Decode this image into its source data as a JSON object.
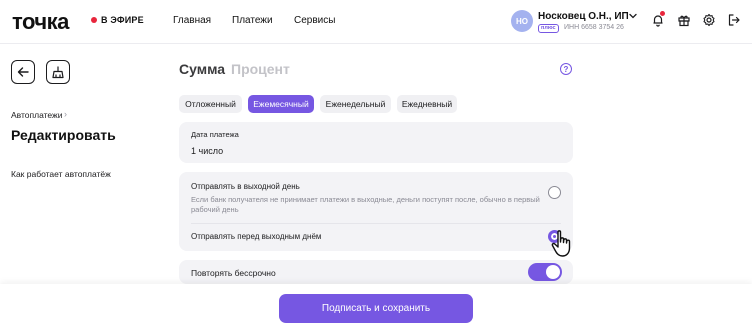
{
  "header": {
    "logo": "точка",
    "live_label": "В ЭФИРЕ",
    "nav": [
      "Главная",
      "Платежи",
      "Сервисы"
    ],
    "user": {
      "initials": "НО",
      "name": "Носковец О.Н., ИП",
      "badge": "плюс",
      "inn": "ИНН 6658 3754 26"
    },
    "icons": [
      "bell-icon",
      "gift-icon",
      "gear-icon",
      "exit-icon"
    ],
    "accent_color": "#7657e2",
    "notif_color": "#e8263c"
  },
  "sidebar": {
    "breadcrumb": "Автоплатежи",
    "title": "Редактировать",
    "help_link": "Как работает автоплатёж"
  },
  "main": {
    "mode_tabs": {
      "active": "Сумма",
      "inactive": "Процент"
    },
    "help": "?",
    "period_chips": [
      "Отложенный",
      "Ежемесячный",
      "Еженедельный",
      "Ежедневный"
    ],
    "selected_period": "Ежемесячный",
    "date": {
      "label": "Дата платежа",
      "value": "1 число"
    },
    "send_options": {
      "option1": {
        "title": "Отправлять в выходной день",
        "description": "Если банк получателя не принимает платежи в выходные, деньги поступят после, обычно в первый рабочий день",
        "selected": false
      },
      "option2": {
        "title": "Отправлять перед выходным днём",
        "selected": true
      }
    },
    "repeat": {
      "label": "Повторять бессрочно",
      "on": true
    }
  },
  "footer": {
    "submit_label": "Подписать и сохранить"
  }
}
